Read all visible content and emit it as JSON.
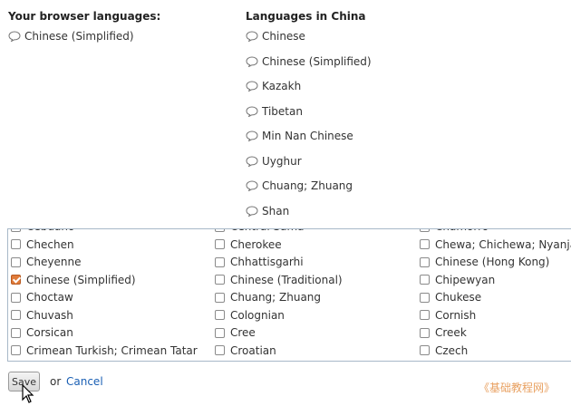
{
  "browser": {
    "heading": "Your browser languages:",
    "languages": [
      "Chinese (Simplified)"
    ]
  },
  "china": {
    "heading": "Languages in China",
    "languages": [
      "Chinese",
      "Chinese (Simplified)",
      "Kazakh",
      "Tibetan",
      "Min Nan Chinese",
      "Uyghur",
      "Chuang; Zhuang",
      "Shan"
    ]
  },
  "list": {
    "columns": [
      [
        {
          "label": "Cebuano",
          "checked": false
        },
        {
          "label": "Chechen",
          "checked": false
        },
        {
          "label": "Cheyenne",
          "checked": false
        },
        {
          "label": "Chinese (Simplified)",
          "checked": true
        },
        {
          "label": "Choctaw",
          "checked": false
        },
        {
          "label": "Chuvash",
          "checked": false
        },
        {
          "label": "Corsican",
          "checked": false
        },
        {
          "label": "Crimean Turkish; Crimean Tatar",
          "checked": false
        }
      ],
      [
        {
          "label": "Central Sama",
          "checked": false
        },
        {
          "label": "Cherokee",
          "checked": false
        },
        {
          "label": "Chhattisgarhi",
          "checked": false
        },
        {
          "label": "Chinese (Traditional)",
          "checked": false
        },
        {
          "label": "Chuang; Zhuang",
          "checked": false
        },
        {
          "label": "Colognian",
          "checked": false
        },
        {
          "label": "Cree",
          "checked": false
        },
        {
          "label": "Croatian",
          "checked": false
        }
      ],
      [
        {
          "label": "Chamorro",
          "checked": false
        },
        {
          "label": "Chewa; Chichewa; Nyanja",
          "checked": false
        },
        {
          "label": "Chinese (Hong Kong)",
          "checked": false
        },
        {
          "label": "Chipewyan",
          "checked": false
        },
        {
          "label": "Chukese",
          "checked": false
        },
        {
          "label": "Cornish",
          "checked": false
        },
        {
          "label": "Creek",
          "checked": false
        },
        {
          "label": "Czech",
          "checked": false
        }
      ]
    ]
  },
  "actions": {
    "save_label": "Save",
    "or_text": "or",
    "cancel_label": "Cancel"
  },
  "watermark": "《基础教程网》",
  "colors": {
    "link": "#1a5fb4",
    "checked": "#e07b3a",
    "watermark": "#e8a060"
  }
}
